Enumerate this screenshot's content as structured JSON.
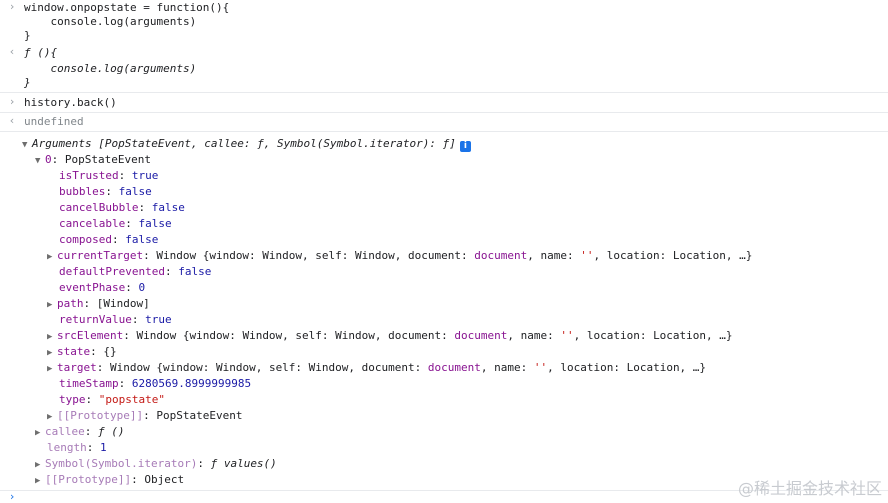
{
  "code1": {
    "line1": "window.onpopstate = function(){",
    "line2": "    console.log(arguments)",
    "line3": "}"
  },
  "result1": {
    "line1": "ƒ (){",
    "line2": "    console.log(arguments)",
    "line3": "}"
  },
  "code2": "history.back()",
  "result2": "undefined",
  "args": {
    "label": "Arguments",
    "preview": "[PopStateEvent, callee: ƒ, Symbol(Symbol.iterator): ƒ]",
    "info": "i",
    "event": {
      "key": "0",
      "value": "PopStateEvent",
      "props": {
        "isTrusted": "true",
        "bubbles": "false",
        "cancelBubble": "false",
        "cancelable": "false",
        "composed": "false",
        "currentTarget_prefix": "Window {window: Window, self: Window, document: ",
        "currentTarget_doc": "document",
        "currentTarget_mid": ", name: ",
        "currentTarget_name": "''",
        "currentTarget_suffix": ", location: Location, …}",
        "defaultPrevented": "false",
        "eventPhase": "0",
        "path": "[Window]",
        "returnValue": "true",
        "srcElement_prefix": "Window {window: Window, self: Window, document: ",
        "srcElement_doc": "document",
        "srcElement_mid": ", name: ",
        "srcElement_name": "''",
        "srcElement_suffix": ", location: Location, …}",
        "state": "{}",
        "target_prefix": "Window {window: Window, self: Window, document: ",
        "target_doc": "document",
        "target_mid": ", name: ",
        "target_name": "''",
        "target_suffix": ", location: Location, …}",
        "timeStamp": "6280569.8999999985",
        "type": "\"popstate\"",
        "prototype": "PopStateEvent"
      }
    },
    "callee": "ƒ ()",
    "length": "1",
    "symbol_key": "Symbol(Symbol.iterator)",
    "symbol_value": "ƒ values()",
    "prototype": "Object"
  },
  "keys": {
    "isTrusted": "isTrusted",
    "bubbles": "bubbles",
    "cancelBubble": "cancelBubble",
    "cancelable": "cancelable",
    "composed": "composed",
    "currentTarget": "currentTarget",
    "defaultPrevented": "defaultPrevented",
    "eventPhase": "eventPhase",
    "path": "path",
    "returnValue": "returnValue",
    "srcElement": "srcElement",
    "state": "state",
    "target": "target",
    "timeStamp": "timeStamp",
    "type": "type",
    "prototype": "[[Prototype]]",
    "callee": "callee",
    "length": "length"
  },
  "watermark": "@稀土掘金技术社区"
}
